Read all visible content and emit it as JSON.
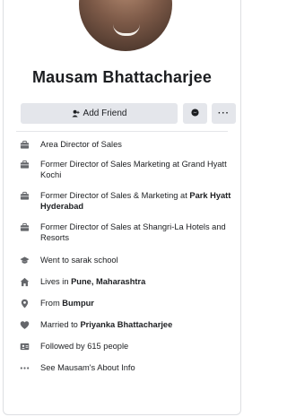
{
  "profile": {
    "name": "Mausam Bhattacharjee"
  },
  "actions": {
    "add_friend_label": "Add Friend",
    "more_label": "···"
  },
  "intro": {
    "items": [
      {
        "icon": "briefcase-icon",
        "text": "Area Director of Sales",
        "bold": ""
      },
      {
        "icon": "briefcase-icon",
        "text": "Former Director of Sales Marketing at Grand Hyatt Kochi",
        "bold": ""
      },
      {
        "icon": "briefcase-icon",
        "text": "Former Director of Sales & Marketing at ",
        "bold": "Park Hyatt Hyderabad"
      },
      {
        "icon": "briefcase-icon",
        "text": "Former Director of Sales at Shangri-La Hotels and Resorts",
        "bold": ""
      },
      {
        "icon": "graduation-cap-icon",
        "text": "Went to sarak school",
        "bold": ""
      },
      {
        "icon": "home-icon",
        "text": "Lives in ",
        "bold": "Pune, Maharashtra"
      },
      {
        "icon": "location-pin-icon",
        "text": "From ",
        "bold": "Bumpur"
      },
      {
        "icon": "heart-icon",
        "text": "Married to ",
        "bold": "Priyanka Bhattacharjee"
      },
      {
        "icon": "followers-icon",
        "text": "Followed by 615 people",
        "bold": ""
      },
      {
        "icon": "more-dots-icon",
        "text": "See Mausam's About Info",
        "bold": ""
      }
    ]
  }
}
